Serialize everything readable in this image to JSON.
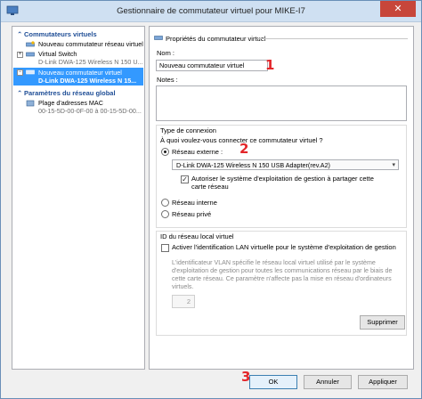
{
  "window": {
    "title": "Gestionnaire de commutateur virtuel pour MIKE-I7",
    "close_glyph": "✕"
  },
  "tree": {
    "virtual_switches_header": "Commutateurs virtuels",
    "new_switch_item": "Nouveau commutateur réseau virtuel",
    "virtual_switch": {
      "label": "Virtual Switch",
      "sub": "D-Link DWA-125 Wireless N 150 U..."
    },
    "selected_switch": {
      "label": "Nouveau commutateur virtuel",
      "sub": "D-Link DWA-125 Wireless N 15..."
    },
    "global_header": "Paramètres du réseau global",
    "mac_range": {
      "label": "Plage d'adresses MAC",
      "sub": "00-15-5D-00-0F-00 à 00-15-5D-00..."
    }
  },
  "props": {
    "section_title": "Propriétés du commutateur virtuel",
    "name_label": "Nom :",
    "name_value": "Nouveau commutateur virtuel",
    "notes_label": "Notes :",
    "connection_type_label": "Type de connexion",
    "connection_question": "À quoi voulez-vous connecter ce commutateur virtuel ?",
    "external_label": "Réseau externe :",
    "adapter_value": "D-Link DWA-125 Wireless N 150 USB Adapter(rev.A2)",
    "allow_mgmt_label": "Autoriser le système d'exploitation de gestion à partager cette carte réseau",
    "internal_label": "Réseau interne",
    "private_label": "Réseau privé",
    "vlan_label": "ID du réseau local virtuel",
    "vlan_checkbox_label": "Activer l'identification LAN virtuelle pour le système d'exploitation de gestion",
    "vlan_info": "L'identificateur VLAN spécifie le réseau local virtuel utilisé par le système d'exploitation de gestion pour toutes les communications réseau par le biais de cette carte réseau. Ce paramètre n'affecte pas la mise en réseau d'ordinateurs virtuels.",
    "vlan_value": "2",
    "remove_button": "Supprimer"
  },
  "buttons": {
    "ok": "OK",
    "cancel": "Annuler",
    "apply": "Appliquer"
  },
  "annotations": {
    "one": "1",
    "two": "2",
    "three": "3"
  },
  "colors": {
    "selection": "#3399ff",
    "header_text": "#1f4e96",
    "annotation": "#e3262a"
  }
}
